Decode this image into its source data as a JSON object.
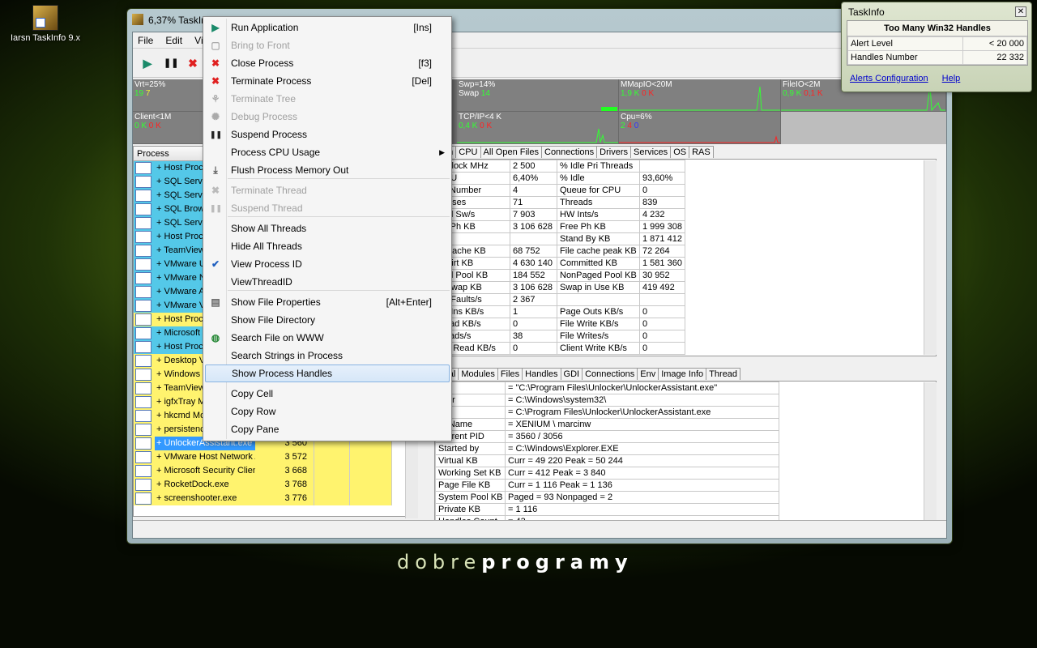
{
  "desktop": {
    "icon_label": "Iarsn TaskInfo 9.x",
    "brand_light": "dobre",
    "brand_bold": "programy"
  },
  "window": {
    "title": "6,37% TaskIn..."
  },
  "menu": [
    "File",
    "Edit",
    "Vie"
  ],
  "graphs": [
    {
      "label": "Vrt=25%",
      "v1": "19",
      "v2": "7",
      "v3": ""
    },
    {
      "label": "Swp=14%",
      "v1": "Swap",
      "v2": "14",
      "v3": ""
    },
    {
      "label": "MMapIO<20M",
      "v1": "1,9 K",
      "v2": "0 K",
      "v3": ""
    },
    {
      "label": "FileIO<2M",
      "v1": "0,9 K",
      "v2": "0,1 K",
      "v3": ""
    },
    {
      "label": "Client<1M",
      "v1": "0 K",
      "v2": "0 K",
      "v3": ""
    },
    {
      "label": "TCP/IP<4 K",
      "v1": "0,4 K",
      "v2": "0 K",
      "v3": ""
    },
    {
      "label": "Cpu=6%",
      "v1": "2",
      "v2": "4",
      "v3": "0"
    }
  ],
  "process_list": {
    "header": "Process",
    "rows": [
      {
        "name": "+ Host Proc",
        "pid": "",
        "color": "cyan"
      },
      {
        "name": "+ SQL Serve",
        "pid": "",
        "color": "cyan"
      },
      {
        "name": "+ SQL Serv",
        "pid": "",
        "color": "cyan"
      },
      {
        "name": "+ SQL Brow",
        "pid": "",
        "color": "cyan"
      },
      {
        "name": "+ SQL Serv",
        "pid": "",
        "color": "cyan"
      },
      {
        "name": "+ Host Proc",
        "pid": "",
        "color": "cyan"
      },
      {
        "name": "+ TeamView",
        "pid": "",
        "color": "cyan"
      },
      {
        "name": "+ VMware U",
        "pid": "",
        "color": "cyan"
      },
      {
        "name": "+ VMware N",
        "pid": "",
        "color": "cyan"
      },
      {
        "name": "+ VMware A",
        "pid": "",
        "color": "cyan"
      },
      {
        "name": "+ VMware V",
        "pid": "",
        "color": "cyan"
      },
      {
        "name": "+ Host Proc",
        "pid": "",
        "color": "yellow"
      },
      {
        "name": "+ Microsoft I",
        "pid": "",
        "color": "cyan"
      },
      {
        "name": "+ Host Proc",
        "pid": "",
        "color": "cyan"
      },
      {
        "name": "+ Desktop V",
        "pid": "",
        "color": "yellow"
      },
      {
        "name": "+ Windows",
        "pid": "",
        "color": "yellow"
      },
      {
        "name": "+ TeamView",
        "pid": "",
        "color": "yellow"
      },
      {
        "name": "+ igfxTray M",
        "pid": "",
        "color": "yellow"
      },
      {
        "name": "+ hkcmd Mo",
        "pid": "",
        "color": "yellow"
      },
      {
        "name": "+ persistenc",
        "pid": "",
        "color": "yellow"
      },
      {
        "name": "+ UnlockerAssistant.exe",
        "pid": "3 560",
        "color": "sel"
      },
      {
        "name": "+ VMware Host Network A",
        "pid": "3 572",
        "color": "yellow"
      },
      {
        "name": "+ Microsoft Security Client",
        "pid": "3 668",
        "color": "yellow"
      },
      {
        "name": "+ RocketDock.exe",
        "pid": "3 768",
        "color": "yellow"
      },
      {
        "name": "+ screenshooter.exe",
        "pid": "3 776",
        "color": "yellow"
      }
    ]
  },
  "sys_tabs": [
    "em",
    "CPU",
    "All Open Files",
    "Connections",
    "Drivers",
    "Services",
    "OS",
    "RAS"
  ],
  "sys_rows": [
    [
      "J Clock MHz",
      "2 500",
      "% Idle Pri Threads",
      ""
    ],
    [
      "CPU",
      "6,40%",
      "% Idle",
      "93,60%"
    ],
    [
      "Js Number",
      "4",
      "Queue for CPU",
      "0"
    ],
    [
      "cesses",
      "71",
      "Threads",
      "839"
    ],
    [
      "ead Sw/s",
      "7 903",
      "HW Ints/s",
      "4 232"
    ],
    [
      "tal Ph KB",
      "3 106 628",
      "Free Ph KB",
      "1 999 308"
    ],
    [
      "",
      "",
      "Stand By KB",
      "1 871 412"
    ],
    [
      "e Cache KB",
      "68 752",
      "File cache peak KB",
      "72 264"
    ],
    [
      "e Virt KB",
      "4 630 140",
      "Committed KB",
      "1 581 360"
    ],
    [
      "ged Pool KB",
      "184 552",
      "NonPaged Pool KB",
      "30 952"
    ],
    [
      "k Swap KB",
      "3 106 628",
      "Swap in Use KB",
      "419 492"
    ],
    [
      "ge Faults/s",
      "2 367",
      "",
      ""
    ],
    [
      "ge Ins KB/s",
      "1",
      "Page Outs KB/s",
      "0"
    ],
    [
      "Read KB/s",
      "0",
      "File Write KB/s",
      "0"
    ],
    [
      "Reads/s",
      "38",
      "File Writes/s",
      "0"
    ],
    [
      "ent Read KB/s",
      "0",
      "Client Write KB/s",
      "0"
    ]
  ],
  "det_tabs": [
    "eral",
    "Modules",
    "Files",
    "Handles",
    "GDI",
    "Connections",
    "Env",
    "Image Info",
    "Thread"
  ],
  "det_rows": [
    [
      "D",
      "= \"C:\\Program Files\\Unlocker\\UnlockerAssistant.exe\""
    ],
    [
      "r Dir",
      "= C:\\Windows\\system32\\"
    ],
    [
      "h",
      "= C:\\Program Files\\Unlocker\\UnlockerAssistant.exe"
    ],
    [
      "er Name",
      "= XENIUM \\ marcinw"
    ],
    [
      "/Parent PID",
      "= 3560 / 3056"
    ],
    [
      "Started by",
      "= C:\\Windows\\Explorer.EXE"
    ],
    [
      "Virtual KB",
      "Curr = 49 220 Peak = 50 244"
    ],
    [
      "Working Set KB",
      "Curr = 412 Peak = 3 840"
    ],
    [
      "Page File KB",
      "Curr = 1 116 Peak = 1 136"
    ],
    [
      "System Pool KB",
      "Paged = 93 Nonpaged = 2"
    ],
    [
      "Private KB",
      "= 1 116"
    ],
    [
      "Handles Count",
      "= 43"
    ]
  ],
  "context_menu": [
    {
      "label": "Run Application",
      "shortcut": "[Ins]",
      "icon": "run-icon",
      "glyph": "▶",
      "color": "#1a8a6a",
      "disabled": false
    },
    {
      "label": "Bring to Front",
      "shortcut": "",
      "icon": "bring-front-icon",
      "glyph": "▢",
      "color": "#aaa",
      "disabled": true
    },
    {
      "label": "Close Process",
      "shortcut": "[f3]",
      "icon": "close-process-icon",
      "glyph": "✖",
      "color": "#e02020",
      "disabled": false
    },
    {
      "label": "Terminate Process",
      "shortcut": "[Del]",
      "icon": "terminate-icon",
      "glyph": "✖",
      "color": "#e02020",
      "disabled": false
    },
    {
      "label": "Terminate Tree",
      "shortcut": "",
      "icon": "tree-icon",
      "glyph": "⚘",
      "color": "#aaa",
      "disabled": true
    },
    {
      "label": "Debug Process",
      "shortcut": "",
      "icon": "bug-icon",
      "glyph": "✺",
      "color": "#aaa",
      "disabled": true
    },
    {
      "label": "Suspend Process",
      "shortcut": "",
      "icon": "pause-icon",
      "glyph": "❚❚",
      "color": "#222",
      "disabled": false
    },
    {
      "label": "Process CPU Usage",
      "shortcut": "",
      "icon": "",
      "glyph": "",
      "color": "",
      "disabled": false,
      "submenu": true
    },
    {
      "label": "Flush Process Memory Out",
      "shortcut": "",
      "icon": "flush-icon",
      "glyph": "⤓",
      "color": "#555",
      "disabled": false
    },
    {
      "label": "Terminate Thread",
      "shortcut": "",
      "icon": "terminate-thread-icon",
      "glyph": "✖",
      "color": "#bbb",
      "disabled": true
    },
    {
      "label": "Suspend Thread",
      "shortcut": "",
      "icon": "suspend-thread-icon",
      "glyph": "❚❚",
      "color": "#bbb",
      "disabled": true
    },
    {
      "label": "Show All Threads",
      "shortcut": "",
      "icon": "",
      "glyph": "",
      "color": "",
      "disabled": false
    },
    {
      "label": "Hide All Threads",
      "shortcut": "",
      "icon": "",
      "glyph": "",
      "color": "",
      "disabled": false
    },
    {
      "label": "View Process ID",
      "shortcut": "",
      "icon": "check-icon",
      "glyph": "✔",
      "color": "#2060c0",
      "disabled": false
    },
    {
      "label": "ViewThreadID",
      "shortcut": "",
      "icon": "",
      "glyph": "",
      "color": "",
      "disabled": false
    },
    {
      "label": "Show File Properties",
      "shortcut": "[Alt+Enter]",
      "icon": "properties-icon",
      "glyph": "▤",
      "color": "#666",
      "disabled": false
    },
    {
      "label": "Show File Directory",
      "shortcut": "",
      "icon": "",
      "glyph": "",
      "color": "",
      "disabled": false
    },
    {
      "label": "Search File on WWW",
      "shortcut": "",
      "icon": "globe-icon",
      "glyph": "◍",
      "color": "#2a8a3a",
      "disabled": false
    },
    {
      "label": "Search Strings in Process",
      "shortcut": "",
      "icon": "",
      "glyph": "",
      "color": "",
      "disabled": false
    },
    {
      "label": "Show Process Handles",
      "shortcut": "",
      "icon": "",
      "glyph": "",
      "color": "",
      "disabled": false,
      "highlighted": true
    },
    {
      "label": "Copy Cell",
      "shortcut": "",
      "icon": "",
      "glyph": "",
      "color": "",
      "disabled": false
    },
    {
      "label": "Copy Row",
      "shortcut": "",
      "icon": "",
      "glyph": "",
      "color": "",
      "disabled": false
    },
    {
      "label": "Copy Pane",
      "shortcut": "",
      "icon": "",
      "glyph": "",
      "color": "",
      "disabled": false
    }
  ],
  "alert": {
    "title": "TaskInfo",
    "heading": "Too Many Win32 Handles",
    "rows": [
      [
        "Alert Level",
        "< 20 000"
      ],
      [
        "Handles Number",
        "22 332"
      ]
    ],
    "link1": "Alerts Configuration",
    "link2": "Help"
  }
}
